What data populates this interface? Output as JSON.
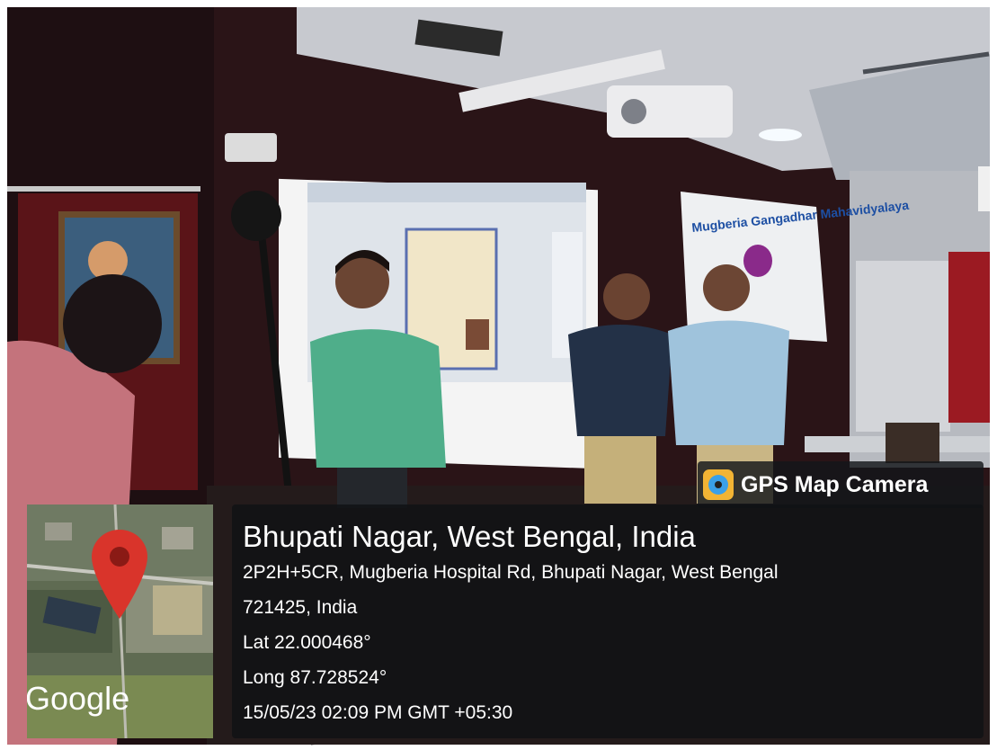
{
  "badge": {
    "app_name": "GPS Map Camera",
    "icon": "gps-map-camera-app-icon"
  },
  "map": {
    "provider_label": "Google",
    "marker_color": "#d9342b",
    "icon": "map-pin-icon"
  },
  "location": {
    "place": "Bhupati Nagar, West Bengal, India",
    "address_line1": "2P2H+5CR, Mugberia Hospital Rd, Bhupati Nagar, West Bengal",
    "address_line2": "721425, India",
    "latitude": "Lat 22.000468°",
    "longitude": "Long 87.728524°",
    "timestamp": "15/05/23 02:09 PM GMT +05:30"
  },
  "scene": {
    "banner_text": "Mugberia Gangadhar Mahavidyalaya",
    "colors": {
      "wall": "#2a1417",
      "screen": "#f4f4f4",
      "shirt_green": "#4fae8a",
      "shirt_blue": "#9fc3dc"
    }
  }
}
